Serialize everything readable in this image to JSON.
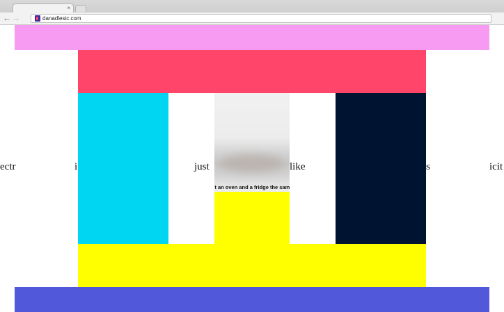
{
  "browser": {
    "tab_close": "×",
    "nav_back": "←",
    "nav_forward": "→",
    "url": "danadlesic.com"
  },
  "colors": {
    "pink": "#f79bf2",
    "red": "#ff4569",
    "cyan": "#00d6f2",
    "navy": "#001330",
    "yellow": "#ffff00",
    "blue": "#5158d9"
  },
  "page": {
    "words": [
      "ectr",
      "i",
      "just",
      "like",
      "s",
      "icit"
    ],
    "caption": "n't an oven and a fridge the sam"
  }
}
